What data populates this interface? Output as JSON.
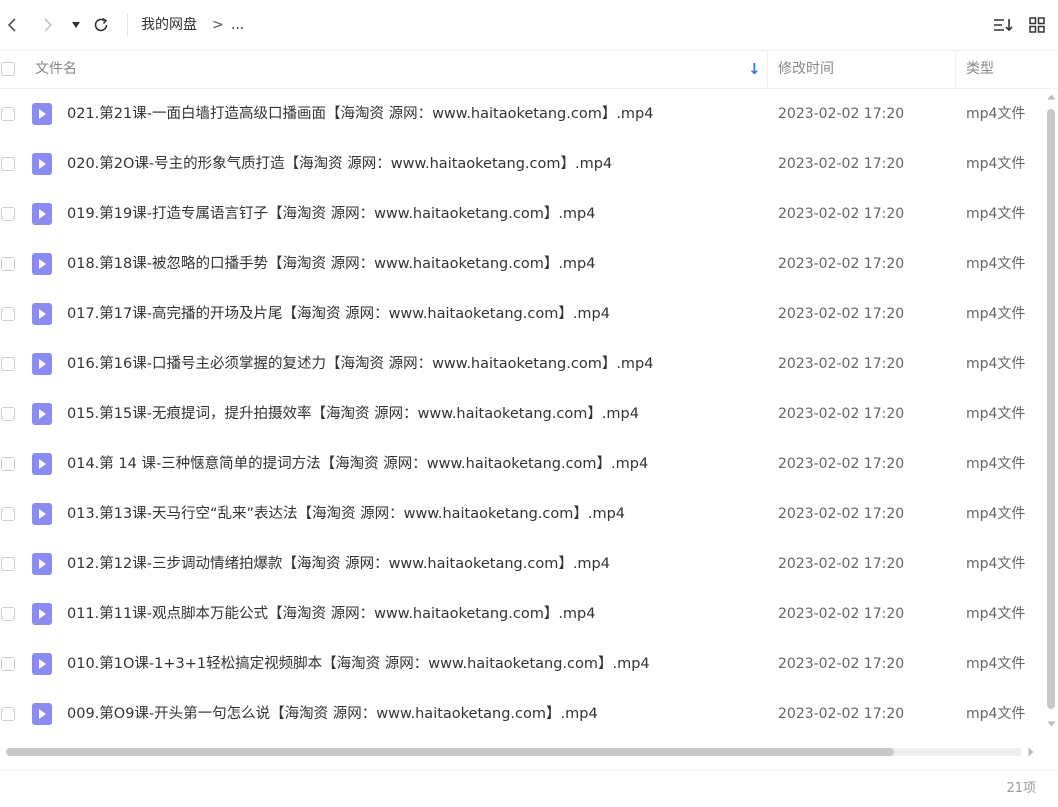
{
  "toolbar": {
    "breadcrumb_root": "我的网盘",
    "breadcrumb_sep": ">",
    "breadcrumb_more": "..."
  },
  "header": {
    "name": "文件名",
    "modified": "修改时间",
    "type": "类型",
    "sort_indicator": "↓"
  },
  "files": [
    {
      "name": "021.第21课-一面白墙打造高级口播画面【海淘资 源网：www.haitaoketang.com】.mp4",
      "modified": "2023-02-02 17:20",
      "type": "mp4文件"
    },
    {
      "name": "020.第2O课-号主的形象气质打造【海淘资 源网：www.haitaoketang.com】.mp4",
      "modified": "2023-02-02 17:20",
      "type": "mp4文件"
    },
    {
      "name": "019.第19课-打造专属语言钉子【海淘资 源网：www.haitaoketang.com】.mp4",
      "modified": "2023-02-02 17:20",
      "type": "mp4文件"
    },
    {
      "name": "018.第18课-被忽略的口播手势【海淘资 源网：www.haitaoketang.com】.mp4",
      "modified": "2023-02-02 17:20",
      "type": "mp4文件"
    },
    {
      "name": "017.第17课-高完播的开场及片尾【海淘资 源网：www.haitaoketang.com】.mp4",
      "modified": "2023-02-02 17:20",
      "type": "mp4文件"
    },
    {
      "name": "016.第16课-口播号主必须掌握的复述力【海淘资 源网：www.haitaoketang.com】.mp4",
      "modified": "2023-02-02 17:20",
      "type": "mp4文件"
    },
    {
      "name": "015.第15课-无痕提词，提升拍摄效率【海淘资 源网：www.haitaoketang.com】.mp4",
      "modified": "2023-02-02 17:20",
      "type": "mp4文件"
    },
    {
      "name": "014.第 14 课-三种惬意简单的提词方法【海淘资 源网：www.haitaoketang.com】.mp4",
      "modified": "2023-02-02 17:20",
      "type": "mp4文件"
    },
    {
      "name": "013.第13课-天马行空“乱来”表达法【海淘资 源网：www.haitaoketang.com】.mp4",
      "modified": "2023-02-02 17:20",
      "type": "mp4文件"
    },
    {
      "name": "012.第12课-三步调动情绪拍爆款【海淘资 源网：www.haitaoketang.com】.mp4",
      "modified": "2023-02-02 17:20",
      "type": "mp4文件"
    },
    {
      "name": "011.第11课-观点脚本万能公式【海淘资 源网：www.haitaoketang.com】.mp4",
      "modified": "2023-02-02 17:20",
      "type": "mp4文件"
    },
    {
      "name": "010.第1O课-1+3+1轻松搞定视频脚本【海淘资 源网：www.haitaoketang.com】.mp4",
      "modified": "2023-02-02 17:20",
      "type": "mp4文件"
    },
    {
      "name": "009.第O9课-开头第一句怎么说【海淘资 源网：www.haitaoketang.com】.mp4",
      "modified": "2023-02-02 17:20",
      "type": "mp4文件"
    }
  ],
  "footer": {
    "count": "21项"
  },
  "colors": {
    "file_icon": "#8b8cf2",
    "sort_arrow": "#2f7cf6",
    "scrollbar": "#c8c8c8"
  }
}
